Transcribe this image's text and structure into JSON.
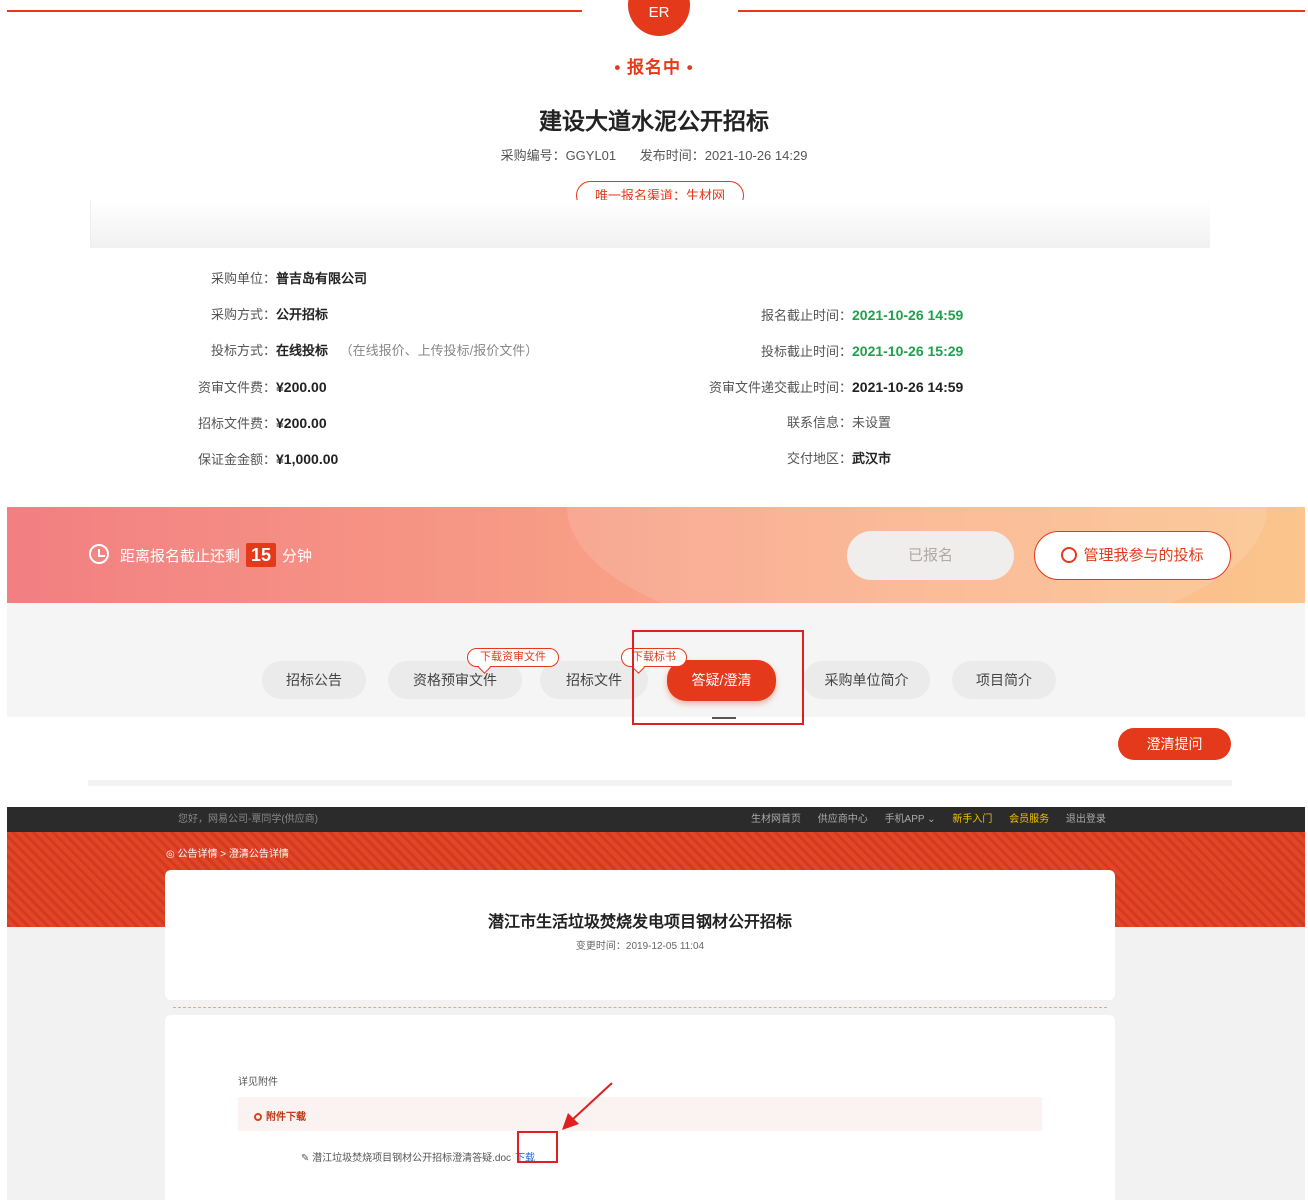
{
  "header": {
    "status": "• 报名中 •",
    "title": "建设大道水泥公开招标",
    "purchase_no": "采购编号：GGYL01",
    "publish_time": "发布时间：2021-10-26 14:29",
    "channel": "唯一报名渠道：生材网"
  },
  "info": {
    "unit_label": "采购单位：",
    "unit": "普吉岛有限公司",
    "method_label": "采购方式：",
    "method": "公开招标",
    "bid_label": "投标方式：",
    "bid": "在线投标",
    "bid_note": "（在线报价、上传投标/报价文件）",
    "review_fee_label": "资审文件费：",
    "review_fee": "¥200.00",
    "tender_fee_label": "招标文件费：",
    "tender_fee": "¥200.00",
    "deposit_label": "保证金金额：",
    "deposit": "¥1,000.00",
    "reg_deadline_label": "报名截止时间：",
    "reg_deadline": "2021-10-26 14:59",
    "bid_deadline_label": "投标截止时间：",
    "bid_deadline": "2021-10-26 15:29",
    "review_deadline_label": "资审文件递交截止时间：",
    "review_deadline": "2021-10-26 14:59",
    "contact_label": "联系信息：",
    "contact": "未设置",
    "delivery_label": "交付地区：",
    "delivery": "武汉市"
  },
  "banner": {
    "countdown_prefix": "距离报名截止还剩",
    "countdown_num": "15",
    "countdown_unit": "分钟",
    "registered_label": "已报名",
    "manage_label": "管理我参与的投标"
  },
  "tabs": [
    {
      "label": "招标公告"
    },
    {
      "label": "资格预审文件",
      "tip": "下载资审文件"
    },
    {
      "label": "招标文件",
      "tip": "下载标书"
    },
    {
      "label": "答疑/澄清",
      "active": true
    },
    {
      "label": "采购单位简介"
    },
    {
      "label": "项目简介"
    }
  ],
  "clarify_button": "澄清提问",
  "detail": {
    "greeting": "您好，网易公司-覃同学(供应商)",
    "nav_links": [
      "生材网首页",
      "供应商中心",
      "手机APP ⌄",
      "新手入门",
      "会员服务",
      "退出登录"
    ],
    "breadcrumb": "◎ 公告详情 > 澄清公告详情",
    "title": "潜江市生活垃圾焚烧发电项目钢材公开招标",
    "change_time": "变更时间：2019-12-05 11:04",
    "see_attachment": "详见附件",
    "attachment_header": "附件下载",
    "file_name": "✎ 潜江垃圾焚烧项目钢材公开招标澄清答疑.doc",
    "download_label": "下载"
  },
  "colors": {
    "accent": "#e4391b",
    "green": "#1fa04a",
    "link": "#1a6fd1"
  }
}
